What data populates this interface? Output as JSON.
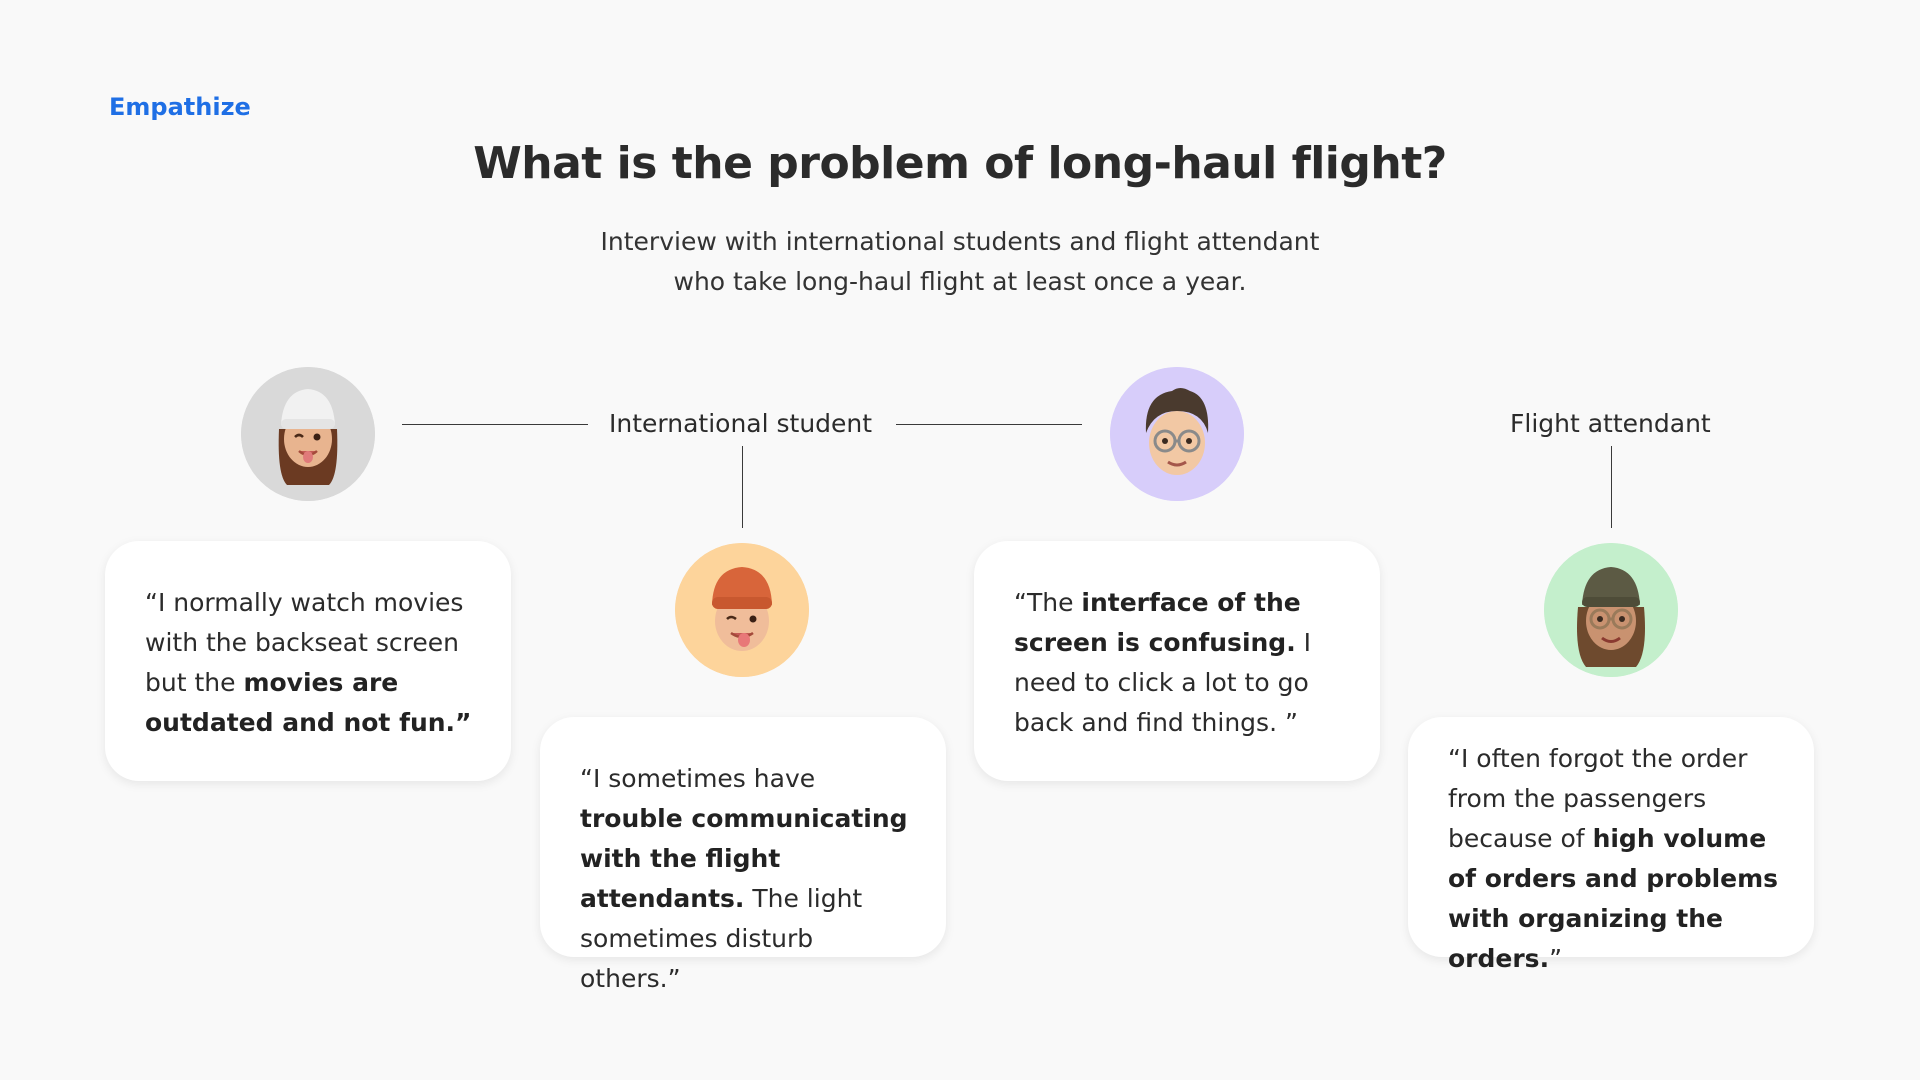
{
  "header": {
    "eyebrow": "Empathize",
    "title": "What is the problem of long-haul flight?",
    "subtitle_line1": "Interview with international students and flight attendant",
    "subtitle_line2": "who take long-haul flight at least once a year."
  },
  "roles": {
    "student": "International student",
    "attendant": "Flight attendant"
  },
  "colors": {
    "accent": "#1f6fe5",
    "avatar1_bg": "#d9d9d9",
    "avatar2_bg": "#fdd49b",
    "avatar3_bg": "#d7cdfa",
    "avatar4_bg": "#c4efcc"
  },
  "avatars": [
    {
      "icon": "memoji-girl-beanie-wink-icon"
    },
    {
      "icon": "memoji-boy-orange-beanie-tongue-icon"
    },
    {
      "icon": "memoji-boy-glasses-icon"
    },
    {
      "icon": "memoji-woman-hat-glasses-icon"
    }
  ],
  "quotes": {
    "q1": {
      "a": "“I normally watch movies with the backseat screen but the ",
      "b": "movies are outdated and not fun.”"
    },
    "q2": {
      "a": "“I sometimes have ",
      "b": "trouble communicating with the flight attendants.",
      "c": " The light sometimes disturb others.”"
    },
    "q3": {
      "a": "“The ",
      "b": "interface of the screen is confusing.",
      "c": " I need to click a lot to go back and find things. ”"
    },
    "q4": {
      "a": "“I often forgot the order from the passengers because of ",
      "b": "high volume of orders and problems with organizing the orders.",
      "c": "”"
    }
  }
}
